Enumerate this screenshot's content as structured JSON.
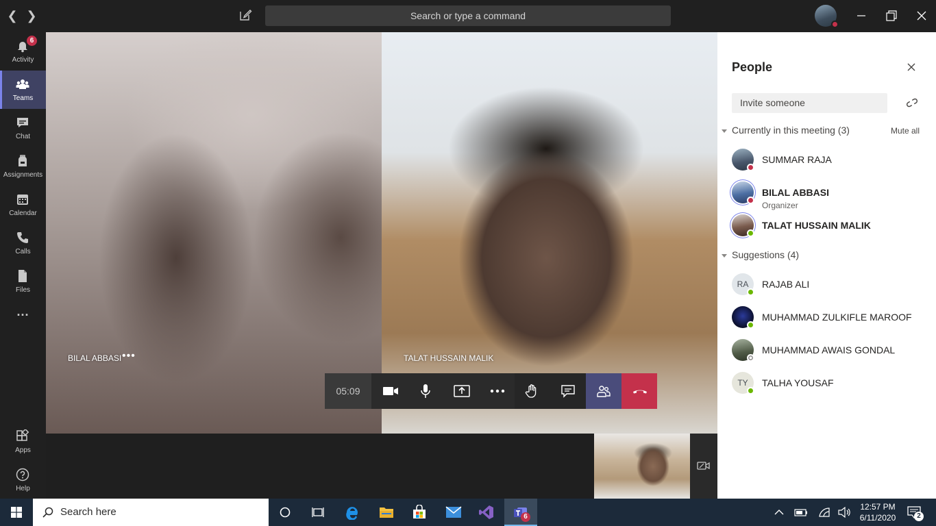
{
  "titlebar": {
    "search_placeholder": "Search or type a command"
  },
  "rail": {
    "activity": {
      "label": "Activity",
      "badge": "6"
    },
    "teams": {
      "label": "Teams"
    },
    "chat": {
      "label": "Chat"
    },
    "assignments": {
      "label": "Assignments"
    },
    "calendar": {
      "label": "Calendar"
    },
    "calls": {
      "label": "Calls"
    },
    "files": {
      "label": "Files"
    },
    "more": {
      "label": "..."
    },
    "apps": {
      "label": "Apps"
    },
    "help": {
      "label": "Help"
    }
  },
  "stage": {
    "tile_left_name": "BILAL ABBASI",
    "tile_right_name": "TALAT HUSSAIN MALIK",
    "timer": "05:09"
  },
  "people_panel": {
    "title": "People",
    "invite_placeholder": "Invite someone",
    "in_meeting_label": "Currently in this meeting (3)",
    "mute_all": "Mute all",
    "in_meeting": [
      {
        "name": "SUMMAR RAJA",
        "role": "",
        "status": "busy"
      },
      {
        "name": "BILAL ABBASI",
        "role": "Organizer",
        "status": "busy"
      },
      {
        "name": "TALAT HUSSAIN MALIK",
        "role": "",
        "status": "available"
      }
    ],
    "suggestions_label": "Suggestions (4)",
    "suggestions": [
      {
        "name": "RAJAB ALI",
        "initials": "RA",
        "status": "available"
      },
      {
        "name": "MUHAMMAD ZULKIFLE MAROOF",
        "initials": "",
        "status": "available"
      },
      {
        "name": "MUHAMMAD AWAIS GONDAL",
        "initials": "",
        "status": "offline"
      },
      {
        "name": "TALHA YOUSAF",
        "initials": "TY",
        "status": "available"
      }
    ]
  },
  "taskbar": {
    "search_text": "Search here",
    "teams_badge": "6",
    "time": "12:57 PM",
    "date": "6/11/2020",
    "notifications": "2"
  },
  "colors": {
    "accent": "#6264a7",
    "busy": "#c4314b",
    "available": "#6bb700",
    "hangup": "#c4314b"
  }
}
